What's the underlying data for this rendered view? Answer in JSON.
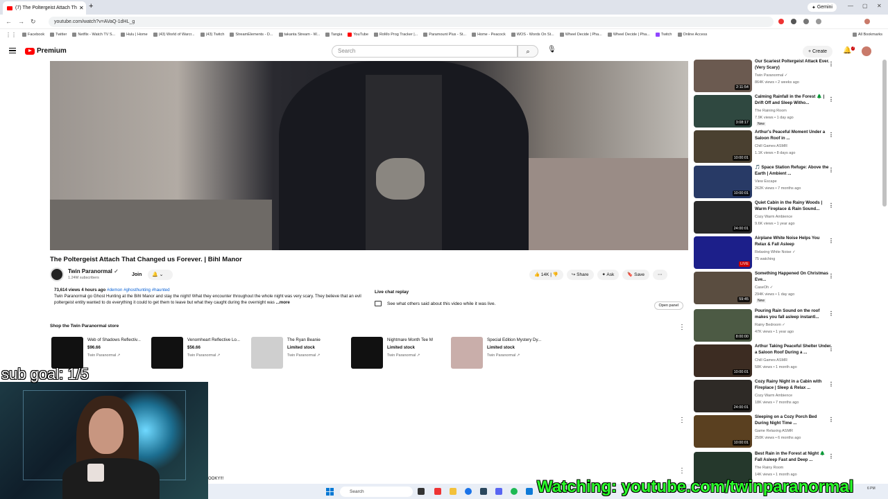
{
  "browser": {
    "tab_title": "(7) The Poltergeist Attach Th",
    "gemini_label": "Gemini",
    "url": "youtube.com/watch?v=AVaQ-1dHL_g",
    "bookmarks": [
      "Facebook",
      "Twitter",
      "Netflix - Watch TV S...",
      "Hulu | Home",
      "(43) World of Warcr...",
      "(43) Twitch",
      "StreamElements - D...",
      "takanta Stream - W...",
      "Tangia",
      "YouTube",
      "RoMo Prog Tracker |...",
      "Paramount Plus - St...",
      "Home - Peacock",
      "WOS - Words On St...",
      "Wheel Decide | Pha...",
      "Wheel Decide | Pha...",
      "Twitch",
      "Online Access"
    ],
    "all_bookmarks": "All Bookmarks"
  },
  "header": {
    "logo": "Premium",
    "search_placeholder": "Search",
    "create_label": "Create",
    "notif_count": "7"
  },
  "video": {
    "title": "The Poltergeist Attach That Changed us Forever. | Bihl Manor",
    "channel": "Twin Paranormal",
    "subs": "1.24M subscribers",
    "join": "Join",
    "likes": "14K",
    "share": "Share",
    "ask": "Ask",
    "save": "Save",
    "desc_meta": "73,614 views  4 hours ago",
    "desc_tags": "#demon #ghosthunting #haunted",
    "desc_text": "Twin Paranormal go Ghost Hunting at the Bihl Manor and stay the night! What they encounter throughout the whole night was very scary. They believe that an evil poltergeist entity wanted to do everything it could to get them to leave but what they caught during the overnight was",
    "desc_more": "...more"
  },
  "live_chat": {
    "heading": "Live chat replay",
    "text": "See what others said about this video while it was live.",
    "open_panel": "Open panel"
  },
  "store": {
    "title": "Shop the Twin Paranormal store",
    "products": [
      {
        "name": "Web of Shadows Reflectiv...",
        "price": "$96.66",
        "seller": "Twin Paranormal ↗"
      },
      {
        "name": "Venomheart Reflective Lo...",
        "price": "$56.66",
        "seller": "Twin Paranormal ↗"
      },
      {
        "name": "The Ryan Beanie",
        "price": "Limited stock",
        "seller": "Twin Paranormal ↗"
      },
      {
        "name": "Nightmare Month Tee M",
        "price": "Limited stock",
        "seller": "Twin Paranormal ↗"
      },
      {
        "name": "Special Edition Mystery Dy...",
        "price": "Limited stock",
        "seller": "Twin Paranormal ↗"
      }
    ]
  },
  "bottom_text": "OOKY!!!",
  "sidebar": [
    {
      "title": "Our Scariest Poltergeist Attack Ever. (Very Scary)",
      "channel": "Twin Paranormal ✓",
      "views": "864K views • 2 weeks ago",
      "duration": "2:11:54",
      "new": "",
      "color": "#6b5a50"
    },
    {
      "title": "Calming Rainfall in the Forest 🌲 | Drift Off and Sleep Witho...",
      "channel": "The Raining Room",
      "views": "7.9K views • 1 day ago",
      "duration": "3:08:17",
      "new": "New",
      "color": "#2f4840"
    },
    {
      "title": "Arthur's Peaceful Moment Under a Saloon Roof in ...",
      "channel": "Chill Games ASMR",
      "views": "1.1K views • 8 days ago",
      "duration": "10:00:01",
      "new": "",
      "color": "#4a4030"
    },
    {
      "title": "🎵 Space Station Refuge: Above the Earth | Ambient ...",
      "channel": "View Escape",
      "views": "262K views • 7 months ago",
      "duration": "10:00:01",
      "new": "",
      "color": "#283a66"
    },
    {
      "title": "Quiet Cabin in the Rainy Woods | Warm Fireplace & Rain Sound...",
      "channel": "Cozy Warm Ambience",
      "views": "9.6K views • 1 year ago",
      "duration": "24:00:01",
      "new": "",
      "color": "#2a2a2a"
    },
    {
      "title": "Airplane White Noise Helps You Relax & Fall Asleep",
      "channel": "Relaxing White Noise ✓",
      "views": "75 watching",
      "duration": "LIVE",
      "new": "",
      "color": "#1c1f8a"
    },
    {
      "title": "Something Happened On Christmas Eve...",
      "channel": "CaseOh ✓",
      "views": "294K views • 1 day ago",
      "duration": "59:45",
      "new": "New",
      "color": "#5a4d40"
    },
    {
      "title": "Pouring Rain Sound on the roof makes you fall asleep instantl...",
      "channel": "Rainy Bedroom ✓",
      "views": "47K views • 1 year ago",
      "duration": "8:00:00",
      "new": "",
      "color": "#4c5a44"
    },
    {
      "title": "Arthur Taking Peaceful Shelter Under a Saloon Roof During a ...",
      "channel": "Chill Games ASMR",
      "views": "58K views • 1 month ago",
      "duration": "10:00:01",
      "new": "",
      "color": "#3c2c22"
    },
    {
      "title": "Cozy Rainy Night in a Cabin with Fireplace | Sleep & Relax ...",
      "channel": "Cozy Warm Ambience",
      "views": "18K views • 7 months ago",
      "duration": "24:00:01",
      "new": "",
      "color": "#2e2a26"
    },
    {
      "title": "Sleeping on a Cozy Porch Bed During Night Time ...",
      "channel": "Game Relaxing ASMR",
      "views": "250K views • 6 months ago",
      "duration": "10:00:01",
      "new": "",
      "color": "#5a4020"
    },
    {
      "title": "Best Rain in the Forest at Night 🌲 Fall Asleep Fast and Deep ...",
      "channel": "The Rainy Room",
      "views": "14K views • 1 month ago",
      "duration": "",
      "new": "",
      "color": "#25382c"
    }
  ],
  "taskbar": {
    "search": "Search",
    "time": "6 PM"
  },
  "overlay": {
    "sub_goal": "sub goal: 1/5",
    "watching": "Watching: youtube.com/twinparanormal"
  }
}
